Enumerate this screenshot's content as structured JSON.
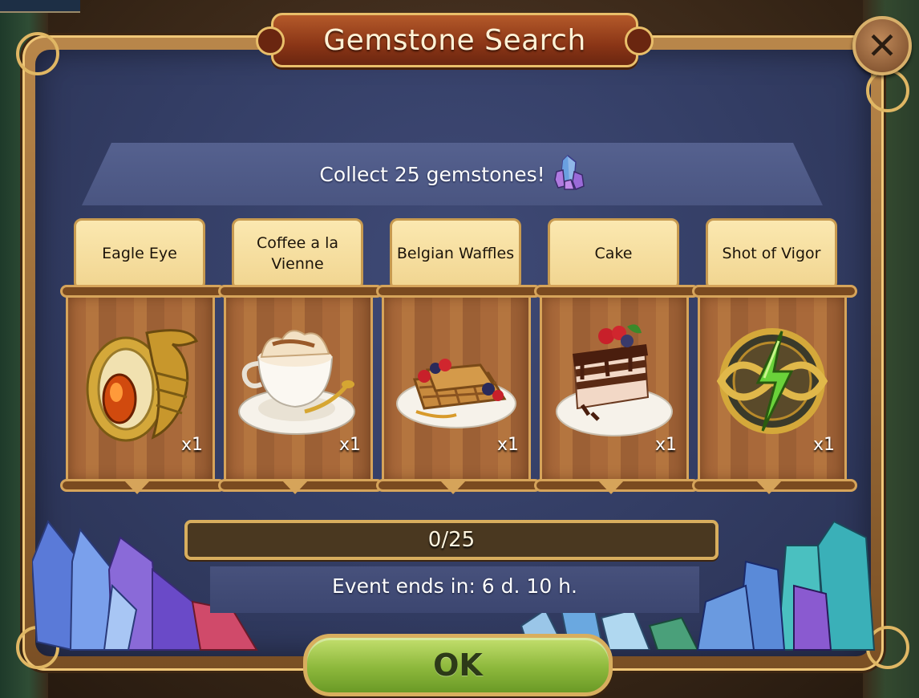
{
  "dialog": {
    "title": "Gemstone Search",
    "objective": "Collect 25 gemstones!",
    "objective_icon": "gemstone-cluster-icon",
    "close_icon": "close-icon"
  },
  "rewards": [
    {
      "name": "Eagle Eye",
      "icon": "eagle-ring-icon",
      "quantity": "x1"
    },
    {
      "name": "Coffee a la Vienne",
      "icon": "coffee-cup-icon",
      "quantity": "x1"
    },
    {
      "name": "Belgian Waffles",
      "icon": "waffles-icon",
      "quantity": "x1"
    },
    {
      "name": "Cake",
      "icon": "cake-slice-icon",
      "quantity": "x1"
    },
    {
      "name": "Shot of Vigor",
      "icon": "lightning-amulet-icon",
      "quantity": "x1"
    }
  ],
  "progress": {
    "current": 0,
    "total": 25,
    "label": "0/25"
  },
  "timer": {
    "text": "Event ends in: 6 d. 10 h."
  },
  "ok_button": {
    "label": "OK"
  },
  "colors": {
    "panel": "#363f68",
    "frame_gold": "#e0b764",
    "title_banner": "#8a3516",
    "label_parchment": "#f5dd9c",
    "ok_green": "#8db83c"
  }
}
